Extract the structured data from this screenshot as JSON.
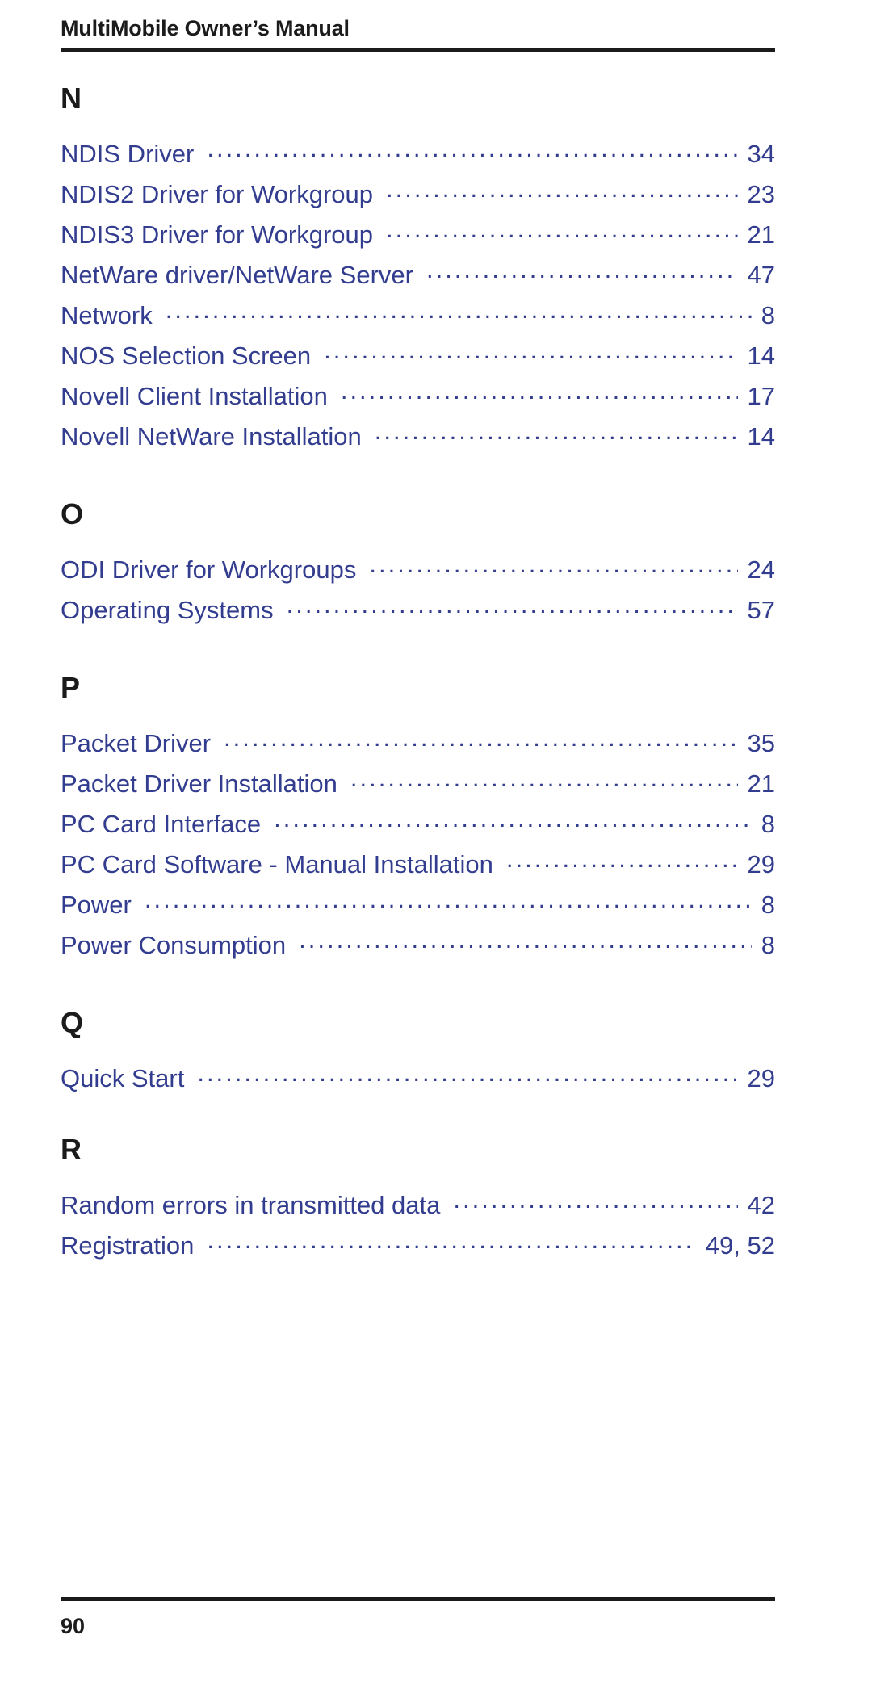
{
  "header": {
    "title": "MultiMobile Owner’s Manual"
  },
  "colors": {
    "entry_text": "#333d8f",
    "heading_text": "#1b1b1b",
    "rule": "#1b1b1b",
    "page_background": "#ffffff"
  },
  "index": {
    "sections": [
      {
        "letter": "N",
        "entries": [
          {
            "label": "NDIS Driver",
            "page": "34"
          },
          {
            "label": "NDIS2 Driver for Workgroup",
            "page": "23"
          },
          {
            "label": "NDIS3 Driver for Workgroup",
            "page": "21"
          },
          {
            "label": "NetWare driver/NetWare Server",
            "page": "47"
          },
          {
            "label": "Network",
            "page": "8"
          },
          {
            "label": "NOS Selection Screen",
            "page": "14"
          },
          {
            "label": "Novell Client Installation",
            "page": "17"
          },
          {
            "label": "Novell NetWare Installation",
            "page": "14"
          }
        ]
      },
      {
        "letter": "O",
        "entries": [
          {
            "label": "ODI Driver for Workgroups",
            "page": "24"
          },
          {
            "label": "Operating Systems",
            "page": "57"
          }
        ]
      },
      {
        "letter": "P",
        "entries": [
          {
            "label": "Packet Driver",
            "page": "35"
          },
          {
            "label": "Packet Driver Installation",
            "page": "21"
          },
          {
            "label": "PC Card Interface",
            "page": "8"
          },
          {
            "label": "PC Card Software - Manual Installation",
            "page": "29"
          },
          {
            "label": "Power",
            "page": "8"
          },
          {
            "label": "Power Consumption",
            "page": "8"
          }
        ]
      },
      {
        "letter": "Q",
        "entries": [
          {
            "label": "Quick Start",
            "page": "29"
          }
        ]
      },
      {
        "letter": "R",
        "entries": [
          {
            "label": "Random errors in transmitted data",
            "page": "42"
          },
          {
            "label": "Registration",
            "page": "49,  52"
          }
        ]
      }
    ]
  },
  "footer": {
    "page_number": "90"
  }
}
